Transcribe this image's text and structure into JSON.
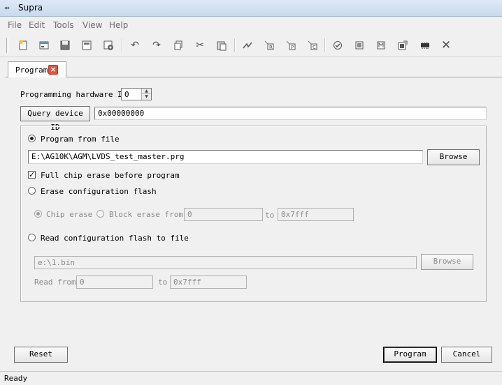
{
  "window": {
    "title": "Supra"
  },
  "menu": [
    "File",
    "Edit",
    "Tools",
    "View",
    "Help"
  ],
  "toolbar": {
    "icons": [
      "new-file-icon",
      "open-icon",
      "save-icon",
      "save-as-icon",
      "settings-icon",
      "undo-icon",
      "redo-icon",
      "copy-icon",
      "cut-icon",
      "paste-icon",
      "link-icon",
      "r-icon",
      "p-icon",
      "c-icon",
      "check-icon",
      "chip-icon-1",
      "chip-icon-2",
      "chip-icon-3",
      "chip-icon-4",
      "close-icon"
    ]
  },
  "tab": {
    "label": "Program"
  },
  "form": {
    "hw_id_label": "Programming hardware ID",
    "hw_id_value": "0",
    "query_button": "Query device ID",
    "device_id_value": "0x00000000",
    "program_from_file_label": "Program from file",
    "file_path": "E:\\AG10K\\AGM\\LVDS_test_master.prg",
    "browse_label": "Browse",
    "full_erase_label": "Full chip erase before program",
    "erase_flash_label": "Erase configuration flash",
    "chip_erase_label": "Chip erase",
    "block_erase_label": "Block erase from",
    "block_from": "0",
    "to_label": "to",
    "block_to": "0x7fff",
    "read_flash_label": "Read configuration flash to file",
    "read_file_path": "e:\\1.bin",
    "browse2_label": "Browse",
    "read_from_label": "Read from",
    "read_from": "0",
    "read_to_label": "to",
    "read_to": "0x7fff"
  },
  "buttons": {
    "reset": "Reset",
    "program": "Program",
    "cancel": "Cancel"
  },
  "status": {
    "text": "Ready"
  }
}
